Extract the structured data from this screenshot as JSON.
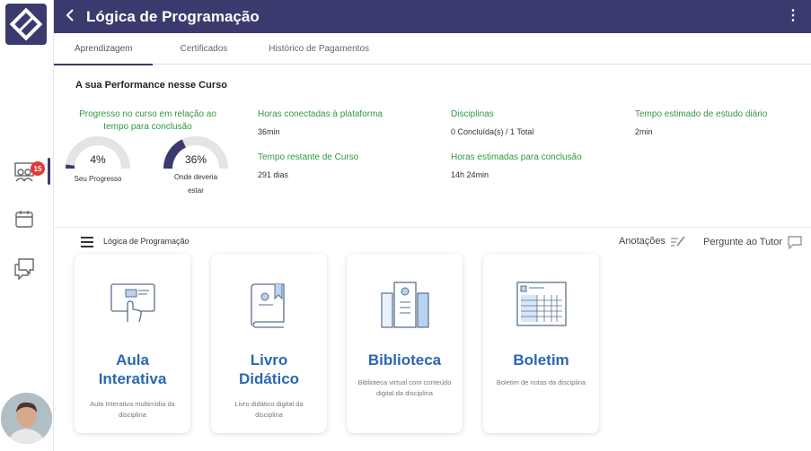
{
  "header": {
    "title": "Lógica de Programação",
    "back_glyph": "‹",
    "menu_glyph": "⋮"
  },
  "tabs": [
    {
      "label": "Aprendizagem",
      "active": true
    },
    {
      "label": "Certificados",
      "active": false
    },
    {
      "label": "Histórico de Pagamentos",
      "active": false
    }
  ],
  "sidebar": {
    "badge_count": "15",
    "icons": [
      "classroom-icon",
      "calendar-icon",
      "chat-icon"
    ]
  },
  "performance": {
    "title": "A sua Performance nesse Curso",
    "progress_label": "Progresso no curso em relação ao tempo para conclusão",
    "my_progress": {
      "value": "4%",
      "fraction": 0.04,
      "caption": "Seu Progresso"
    },
    "expected_progress": {
      "value": "36%",
      "fraction": 0.36,
      "caption": "Onde deveria estar"
    },
    "stats": {
      "hours_connected": {
        "label": "Horas conectadas à plataforma",
        "value": "36min"
      },
      "time_remaining": {
        "label": "Tempo restante de Curso",
        "value": "291 dias"
      },
      "disciplines": {
        "label": "Disciplinas",
        "value": "0 Concluída(s) / 1 Total"
      },
      "hours_estimated": {
        "label": "Horas estimadas para conclusão",
        "value": "14h 24min"
      },
      "daily_time": {
        "label": "Tempo estimado de estudo diário",
        "value": "2min"
      }
    }
  },
  "course_bar": {
    "name": "Lógica de Programação",
    "notes_label": "Anotações",
    "tutor_label": "Pergunte ao Tutor"
  },
  "cards": [
    {
      "title_line1": "Aula",
      "title_line2": "Interativa",
      "desc": "Aula Interativa multimídia da disciplina"
    },
    {
      "title_line1": "Livro",
      "title_line2": "Didático",
      "desc": "Livro didático digital da disciplina"
    },
    {
      "title_line1": "Biblioteca",
      "title_line2": "",
      "desc": "Biblioteca virtual com conteúdo digital da disciplina"
    },
    {
      "title_line1": "Boletim",
      "title_line2": "",
      "desc": "Boletim de notas da disciplina"
    }
  ],
  "colors": {
    "primary": "#3b3a6e",
    "green": "#2e9a3e",
    "card_title": "#2b67b1",
    "badge": "#e53935"
  }
}
